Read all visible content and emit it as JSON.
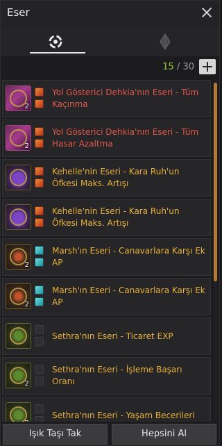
{
  "window": {
    "title": "Eser"
  },
  "tabs": [
    {
      "icon": "rings-icon",
      "active": true
    },
    {
      "icon": "crystal-icon",
      "active": false
    }
  ],
  "counter": {
    "current": "15",
    "separator": " / ",
    "total": "30"
  },
  "items": [
    {
      "name": "Yol Gösterici Dehkia'nın Eseri - Tüm Kaçınma",
      "color": "red",
      "art": "rare-red",
      "level": "2",
      "slots": [
        "red",
        "red"
      ]
    },
    {
      "name": "Yol Gösterici Dehkia'nın Eseri - Tüm Hasar Azaltma",
      "color": "red",
      "art": "rare-red",
      "level": "2",
      "slots": [
        "red",
        "red"
      ]
    },
    {
      "name": "Kehelle'nin Eseri - Kara Ruh'un Öfkesi Maks. Artışı",
      "color": "gold",
      "art": "rare-purple",
      "level": "",
      "slots": [
        "red",
        "red"
      ]
    },
    {
      "name": "Kehelle'nin Eseri - Kara Ruh'un Öfkesi Maks. Artışı",
      "color": "gold",
      "art": "rare-purple",
      "level": "",
      "slots": [
        "red",
        "red"
      ]
    },
    {
      "name": "Marsh'ın Eseri - Canavarlara Karşı Ek AP",
      "color": "gold",
      "art": "rare-orange",
      "level": "2",
      "slots": [
        "teal",
        "teal"
      ]
    },
    {
      "name": "Marsh'ın Eseri - Canavarlara Karşı Ek AP",
      "color": "gold",
      "art": "rare-orange",
      "level": "2",
      "slots": [
        "teal",
        "teal"
      ]
    },
    {
      "name": "Sethra'nın Eseri - Ticaret EXP",
      "color": "gold",
      "art": "rare-green",
      "level": "",
      "slots": [
        "empty",
        "empty"
      ]
    },
    {
      "name": "Sethra'nın Eseri - İşleme Başarı Oranı",
      "color": "gold",
      "art": "rare-green",
      "level": "2",
      "slots": [
        "empty",
        "empty"
      ]
    },
    {
      "name": "Sethra'nın Eseri - Yaşam Becerileri",
      "color": "gold",
      "art": "rare-green",
      "level": "2",
      "slots": [
        "empty",
        "empty"
      ]
    }
  ],
  "footer": {
    "left_button": "Işık Taşı Tak",
    "right_button": "Hepsini Al"
  }
}
